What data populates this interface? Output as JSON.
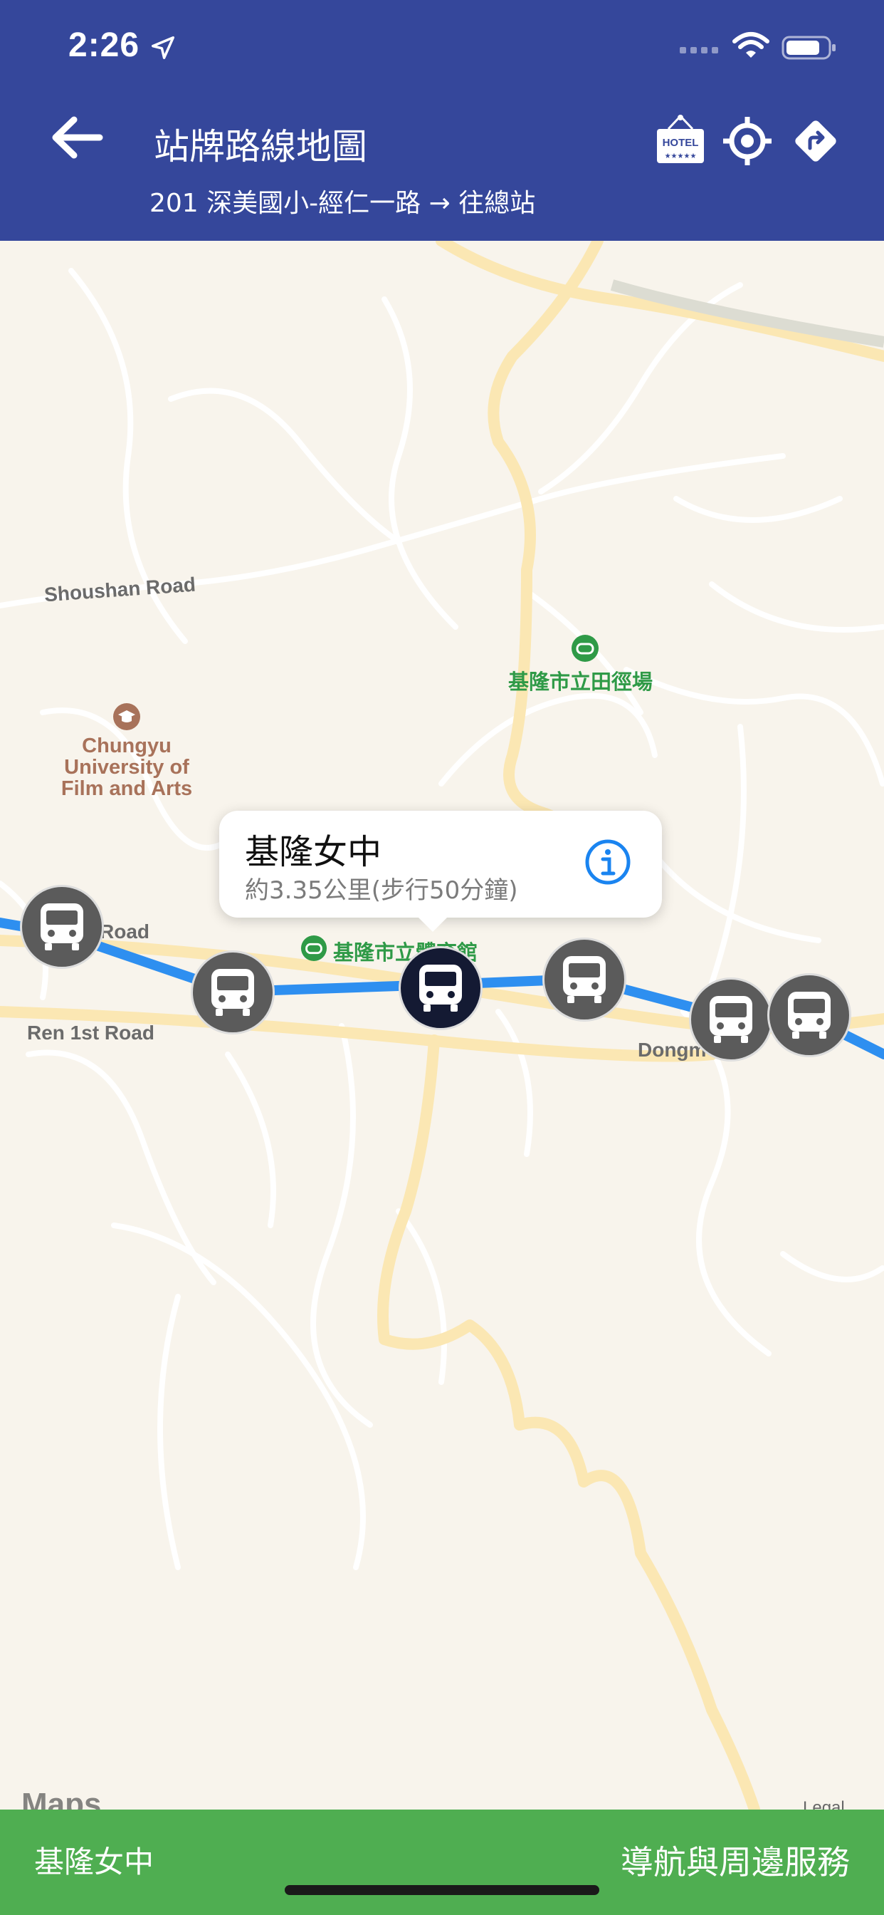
{
  "status_bar": {
    "time": "2:26"
  },
  "header": {
    "title": "站牌路線地圖",
    "subtitle": "201 深美國小-經仁一路 → 往總站",
    "hotel_sign_text": "HOTEL",
    "hotel_sign_stars": "★★★★★",
    "icons": [
      "back-arrow-icon",
      "hotel-icon",
      "locate-icon",
      "directions-icon"
    ]
  },
  "map": {
    "road_labels": {
      "shoushan": "Shoushan Road",
      "road_left": "Road",
      "ren1st": "Ren 1st Road",
      "dongm": "Dongm"
    },
    "pois": {
      "university": "Chungyu\nUniversity of\nFilm and Arts",
      "stadium": "基隆市立田徑場",
      "gym": "基隆市立體育館"
    },
    "maps_brand": "Maps",
    "legal": "Legal"
  },
  "callout": {
    "stop_name": "基隆女中",
    "detail": "約3.35公里(步行50分鐘)"
  },
  "bottom_bar": {
    "stop_name": "基隆女中",
    "nav_label": "導航與周邊服務"
  },
  "colors": {
    "header_bg": "#35479b",
    "route_line": "#2e8ff0",
    "bottom_bar": "#4fae51",
    "marker": "#5b5b5b",
    "marker_selected": "#141a33"
  }
}
